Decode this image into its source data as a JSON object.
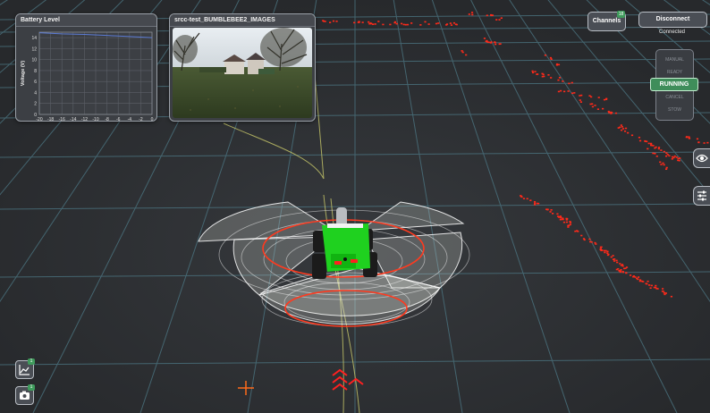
{
  "battery_panel": {
    "title": "Battery Level",
    "chart_data": {
      "type": "line",
      "ylabel": "Voltage (V)",
      "xlabel": "",
      "xlim": [
        -20,
        0
      ],
      "ylim": [
        0,
        15
      ],
      "x_ticks": [
        "-20",
        "-18",
        "-16",
        "-14",
        "-12",
        "-10",
        "-8",
        "-6",
        "-4",
        "-2",
        "0"
      ],
      "y_ticks": [
        "0",
        "2",
        "4",
        "6",
        "8",
        "10",
        "12",
        "14"
      ],
      "series": [
        {
          "x": [
            -20,
            -16,
            -12,
            -8,
            -4,
            0
          ],
          "values": [
            14.9,
            14.7,
            14.6,
            14.4,
            14.2,
            14.0
          ]
        }
      ],
      "grid": true,
      "line_color": "#5b7bd5"
    }
  },
  "camera_panel": {
    "title": "srcc-test_BUMBLEBEE2_IMAGES"
  },
  "header": {
    "channels_label": "Channels",
    "channels_badge": "18",
    "disconnect_label": "Disconnect",
    "connection_status": "Connected"
  },
  "modes": {
    "items": [
      "MANUAL",
      "READY",
      "RUNNING",
      "CANCEL",
      "STOW"
    ],
    "active": "RUNNING",
    "active_color": "#3f8d5a"
  },
  "side_tools": {
    "icons": [
      "eye-icon",
      "sliders-icon"
    ]
  },
  "corner_tools": {
    "chart_badge": "1",
    "camera_badge": "1",
    "icons": [
      "line-chart-icon",
      "camera-icon"
    ]
  },
  "colors": {
    "background": "#2b2d30",
    "grid": "#5a7f8a",
    "lidar": "#ff2a1a",
    "robot": "#1fd11f",
    "path": "#d9d96a"
  }
}
